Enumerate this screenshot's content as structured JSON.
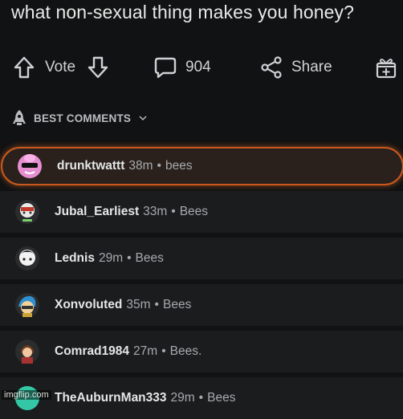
{
  "post": {
    "title": "what non-sexual thing makes you honey?"
  },
  "actions": {
    "vote_label": "Vote",
    "comment_count": "904",
    "share_label": "Share"
  },
  "sort": {
    "label": "BEST COMMENTS"
  },
  "comments": [
    {
      "user": "drunktwattt",
      "time": "38m",
      "text": "bees",
      "highlighted": true
    },
    {
      "user": "Jubal_Earliest",
      "time": "33m",
      "text": "Bees"
    },
    {
      "user": "Lednis",
      "time": "29m",
      "text": "Bees"
    },
    {
      "user": "Xonvoluted",
      "time": "35m",
      "text": "Bees"
    },
    {
      "user": "Comrad1984",
      "time": "27m",
      "text": "Bees."
    },
    {
      "user": "TheAuburnMan333",
      "time": "29m",
      "text": "Bees"
    }
  ],
  "separator": "•",
  "watermark": "imgflip.com",
  "colors": {
    "background": "#111213",
    "row": "#1b1c1d",
    "highlight_border": "#c9591e"
  }
}
